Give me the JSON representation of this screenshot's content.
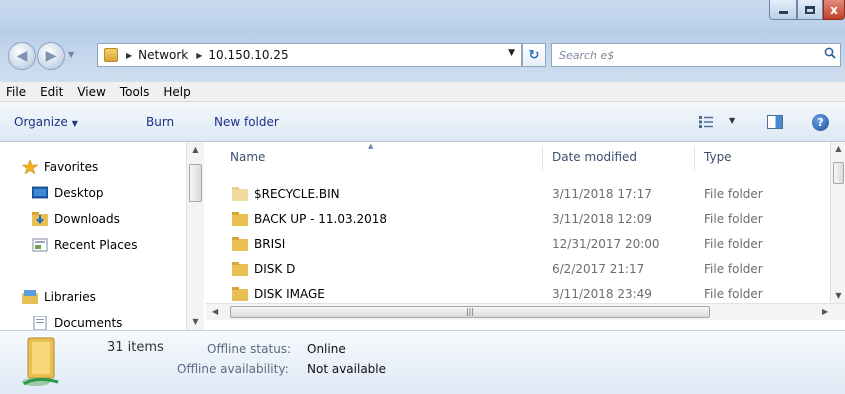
{
  "window": {
    "minimize_glyph": "—",
    "maximize_glyph": "□",
    "close_glyph": "x"
  },
  "address": {
    "crumbs": [
      "Network",
      "10.150.10.25"
    ],
    "search_placeholder": "Search e$"
  },
  "menu": [
    "File",
    "Edit",
    "View",
    "Tools",
    "Help"
  ],
  "toolbar": {
    "organize": "Organize",
    "burn": "Burn",
    "new_folder": "New folder"
  },
  "nav": {
    "favorites": "Favorites",
    "desktop": "Desktop",
    "downloads": "Downloads",
    "recent_places": "Recent Places",
    "libraries": "Libraries",
    "documents": "Documents"
  },
  "columns": {
    "name": "Name",
    "date": "Date modified",
    "type": "Type"
  },
  "files": [
    {
      "name": "$RECYCLE.BIN",
      "date": "3/11/2018 17:17",
      "type": "File folder"
    },
    {
      "name": "BACK UP - 11.03.2018",
      "date": "3/11/2018 12:09",
      "type": "File folder"
    },
    {
      "name": "BRISI",
      "date": "12/31/2017 20:00",
      "type": "File folder"
    },
    {
      "name": "DISK D",
      "date": "6/2/2017 21:17",
      "type": "File folder"
    },
    {
      "name": "DISK IMAGE",
      "date": "3/11/2018 23:49",
      "type": "File folder"
    }
  ],
  "details": {
    "item_count": "31 items",
    "offline_status_label": "Offline status:",
    "offline_status_value": "Online",
    "offline_availability_label": "Offline availability:",
    "offline_availability_value": "Not available"
  },
  "colors": {
    "titlebar": "#c8d9ee",
    "command_text": "#1e3287",
    "folder": "#e8bf52"
  }
}
